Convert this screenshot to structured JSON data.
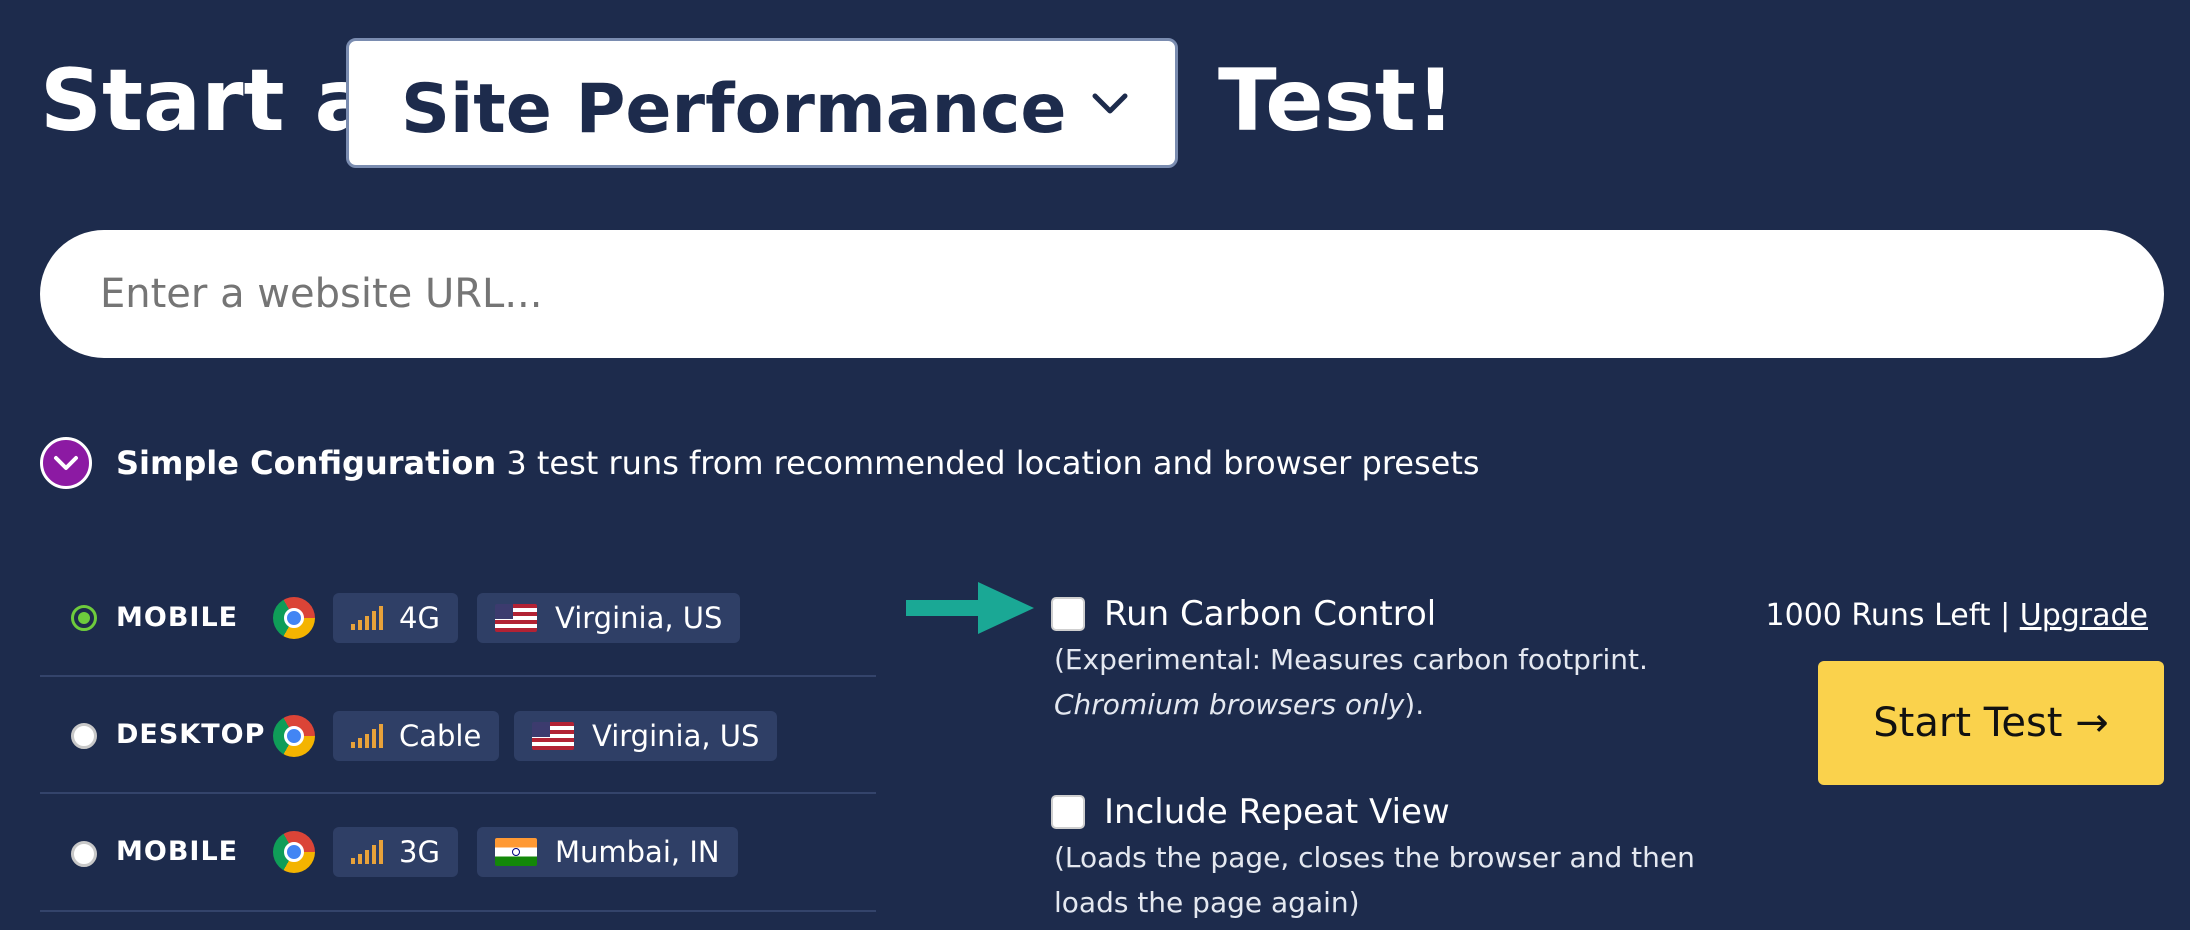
{
  "header": {
    "prefix": "Start a",
    "test_type": "Site Performance",
    "suffix": "Test!",
    "caret_icon": "chevron-down-icon"
  },
  "url_input": {
    "placeholder": "Enter a website URL..."
  },
  "config": {
    "title": "Simple Configuration",
    "description": "3 test runs from recommended location and browser presets",
    "toggle_icon": "chevron-down-icon"
  },
  "presets": [
    {
      "device": "MOBILE",
      "selected": true,
      "browser": "chrome-icon",
      "connection": "4G",
      "location": "Virginia, US",
      "flag": "us-flag-icon"
    },
    {
      "device": "DESKTOP",
      "selected": false,
      "browser": "chrome-icon",
      "connection": "Cable",
      "location": "Virginia, US",
      "flag": "us-flag-icon"
    },
    {
      "device": "MOBILE",
      "selected": false,
      "browser": "chrome-icon",
      "connection": "3G",
      "location": "Mumbai, IN",
      "flag": "india-flag-icon"
    }
  ],
  "options": {
    "carbon": {
      "label": "Run Carbon Control",
      "desc_prefix": "(Experimental: Measures carbon footprint.",
      "desc_italic": "Chromium browsers only",
      "desc_suffix": ")."
    },
    "repeat": {
      "label": "Include Repeat View",
      "desc": "(Loads the page, closes the browser and then loads the page again)"
    }
  },
  "sidebar": {
    "runs_left": "1000 Runs Left",
    "separator": "|",
    "upgrade": "Upgrade",
    "start_button": "Start Test →"
  },
  "colors": {
    "background": "#1d2b4c",
    "pill": "#2f3f66",
    "start_button": "#fad24c",
    "toggle": "#8c1aa3",
    "arrow": "#1aa895",
    "radio_selected": "#6ecb3c",
    "signal_bars": "#e8a23a"
  }
}
